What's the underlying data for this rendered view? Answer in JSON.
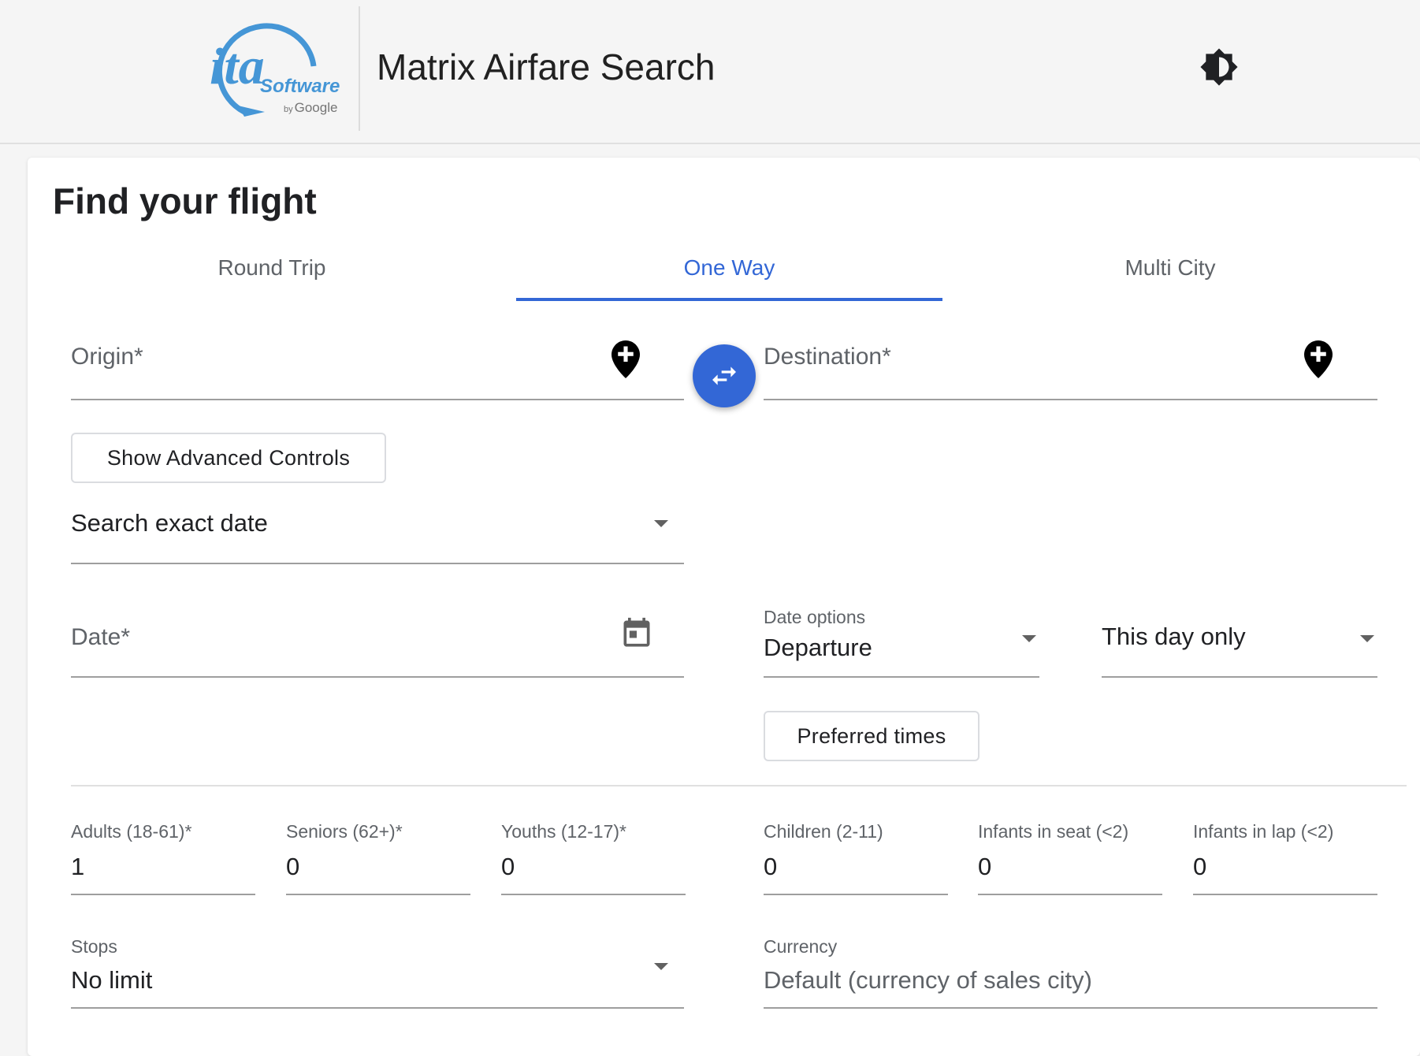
{
  "header": {
    "logo_main": "ita",
    "logo_sub": "Software",
    "logo_by": "by",
    "logo_google": "Google",
    "title": "Matrix Airfare Search",
    "theme_icon": "brightness-icon"
  },
  "search": {
    "title": "Find your flight",
    "tabs": [
      {
        "label": "Round Trip",
        "active": false
      },
      {
        "label": "One Way",
        "active": true
      },
      {
        "label": "Multi City",
        "active": false
      }
    ],
    "origin": {
      "placeholder": "Origin*",
      "icon": "add-location-icon"
    },
    "destination": {
      "placeholder": "Destination*",
      "icon": "add-location-icon"
    },
    "swap_icon": "swap-horiz-icon",
    "advanced_button": "Show Advanced Controls",
    "date_mode": {
      "value": "Search exact date"
    },
    "date": {
      "placeholder": "Date*",
      "icon": "calendar-icon"
    },
    "date_options": {
      "label": "Date options",
      "value": "Departure"
    },
    "date_range": {
      "value": "This day only"
    },
    "preferred_times_button": "Preferred times",
    "passengers": [
      {
        "label": "Adults (18-61)*",
        "value": "1"
      },
      {
        "label": "Seniors (62+)*",
        "value": "0"
      },
      {
        "label": "Youths (12-17)*",
        "value": "0"
      },
      {
        "label": "Children (2-11)",
        "value": "0"
      },
      {
        "label": "Infants in seat (<2)",
        "value": "0"
      },
      {
        "label": "Infants in lap (<2)",
        "value": "0"
      }
    ],
    "stops": {
      "label": "Stops",
      "value": "No limit"
    },
    "currency": {
      "label": "Currency",
      "placeholder": "Default (currency of sales city)"
    }
  },
  "colors": {
    "accent": "#3367d6",
    "logo": "#4596d6"
  }
}
